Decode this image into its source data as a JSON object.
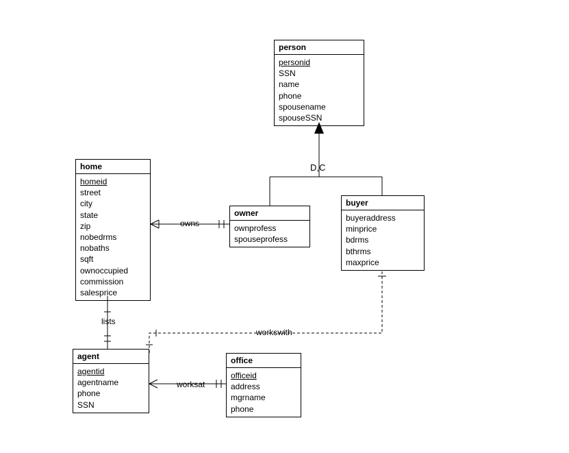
{
  "entities": {
    "person": {
      "title": "person",
      "key": "personid",
      "attrs": [
        "SSN",
        "name",
        "phone",
        "spousename",
        "spouseSSN"
      ]
    },
    "home": {
      "title": "home",
      "key": "homeid",
      "attrs": [
        "street",
        "city",
        "state",
        "zip",
        "nobedrms",
        "nobaths",
        "sqft",
        "ownoccupied",
        "commission",
        "salesprice"
      ]
    },
    "owner": {
      "title": "owner",
      "key": null,
      "attrs": [
        "ownprofess",
        "spouseprofess"
      ]
    },
    "buyer": {
      "title": "buyer",
      "key": null,
      "attrs": [
        "buyeraddress",
        "minprice",
        "bdrms",
        "bthrms",
        "maxprice"
      ]
    },
    "agent": {
      "title": "agent",
      "key": "agentid",
      "attrs": [
        "agentname",
        "phone",
        "SSN"
      ]
    },
    "office": {
      "title": "office",
      "key": "officeid",
      "attrs": [
        "address",
        "mgrname",
        "phone"
      ]
    }
  },
  "relationships": {
    "owns": "owns",
    "lists": "lists",
    "worksat": "worksat",
    "workswith": "workswith"
  },
  "constraint": "D,C"
}
